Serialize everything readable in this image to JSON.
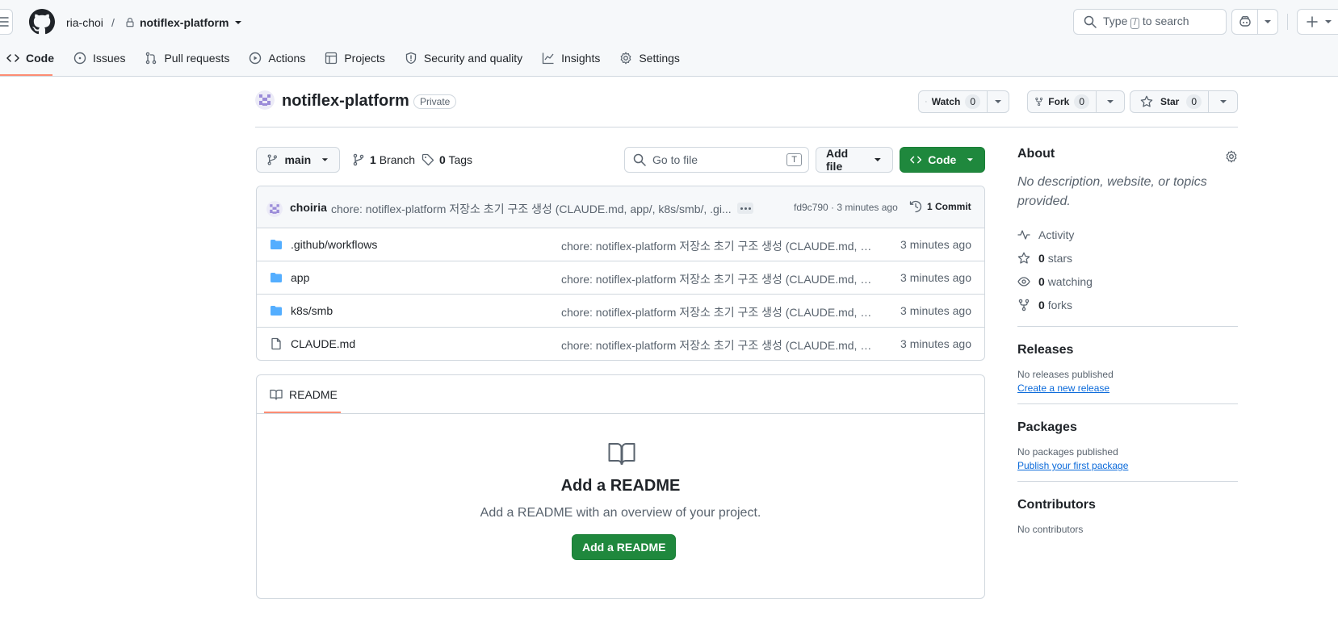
{
  "header": {
    "owner": "ria-choi",
    "separator": "/",
    "repo": "notiflex-platform",
    "search_prefix": "Type",
    "search_key": "/",
    "search_suffix": "to search"
  },
  "tabs": [
    {
      "label": "Code",
      "icon": "code-icon",
      "selected": true
    },
    {
      "label": "Issues",
      "icon": "issue-icon"
    },
    {
      "label": "Pull requests",
      "icon": "pull-request-icon"
    },
    {
      "label": "Actions",
      "icon": "play-icon"
    },
    {
      "label": "Projects",
      "icon": "table-icon"
    },
    {
      "label": "Security and quality",
      "icon": "shield-icon"
    },
    {
      "label": "Insights",
      "icon": "graph-icon"
    },
    {
      "label": "Settings",
      "icon": "gear-icon"
    }
  ],
  "repo": {
    "name": "notiflex-platform",
    "visibility": "Private",
    "watch_label": "Watch",
    "watch_count": "0",
    "fork_label": "Fork",
    "fork_count": "0",
    "star_label": "Star",
    "star_count": "0"
  },
  "toolbar": {
    "branch": "main",
    "branch_count": "1",
    "branch_label": "Branch",
    "tag_count": "0",
    "tag_label": "Tags",
    "goto_placeholder": "Go to file",
    "goto_key": "T",
    "add_file": "Add file",
    "code": "Code"
  },
  "commit": {
    "author": "choiria",
    "message": "chore: notiflex-platform 저장소 초기 구조 생성 (CLAUDE.md, app/, k8s/smb/, .gi...",
    "meta": "fd9c790 · 3 minutes ago",
    "count_label": "1 Commit"
  },
  "files": [
    {
      "name": ".github/workflows",
      "type": "folder",
      "message": "chore: notiflex-platform 저장소 초기 구조 생성 (CLAUDE.md, a...",
      "time": "3 minutes ago"
    },
    {
      "name": "app",
      "type": "folder",
      "message": "chore: notiflex-platform 저장소 초기 구조 생성 (CLAUDE.md, a...",
      "time": "3 minutes ago"
    },
    {
      "name": "k8s/smb",
      "type": "folder",
      "message": "chore: notiflex-platform 저장소 초기 구조 생성 (CLAUDE.md, a...",
      "time": "3 minutes ago"
    },
    {
      "name": "CLAUDE.md",
      "type": "file",
      "message": "chore: notiflex-platform 저장소 초기 구조 생성 (CLAUDE.md, a...",
      "time": "3 minutes ago"
    }
  ],
  "readme": {
    "tab": "README",
    "title": "Add a README",
    "subtitle": "Add a README with an overview of your project.",
    "button": "Add a README"
  },
  "sidebar": {
    "about_title": "About",
    "about_desc": "No description, website, or topics provided.",
    "activity": "Activity",
    "stars_count": "0",
    "stars_label": "stars",
    "watching_count": "0",
    "watching_label": "watching",
    "forks_count": "0",
    "forks_label": "forks",
    "releases_title": "Releases",
    "releases_empty": "No releases published",
    "releases_link": "Create a new release",
    "packages_title": "Packages",
    "packages_empty": "No packages published",
    "packages_link": "Publish your first package",
    "contributors_title": "Contributors",
    "contributors_empty": "No contributors"
  },
  "colors": {
    "accent_green": "#1f883d",
    "link_blue": "#0969da",
    "tab_underline": "#fd8c73",
    "folder_blue": "#54aeff"
  }
}
